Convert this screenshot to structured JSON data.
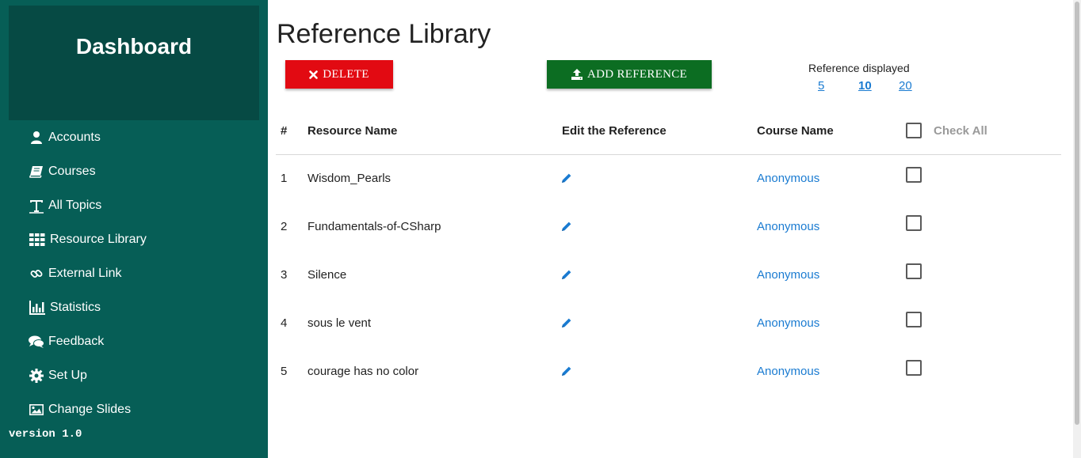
{
  "sidebar": {
    "brand": "Dashboard",
    "items": [
      {
        "label": "Accounts",
        "icon": "user-icon"
      },
      {
        "label": "Courses",
        "icon": "book-icon"
      },
      {
        "label": "All Topics",
        "icon": "text-icon"
      },
      {
        "label": "Resource Library",
        "icon": "grid-icon"
      },
      {
        "label": "External Link",
        "icon": "link-icon"
      },
      {
        "label": "Statistics",
        "icon": "bar-chart-icon"
      },
      {
        "label": "Feedback",
        "icon": "comments-icon"
      },
      {
        "label": "Set Up",
        "icon": "gear-icon"
      },
      {
        "label": "Change Slides",
        "icon": "image-icon"
      }
    ],
    "version": "version 1.0"
  },
  "main": {
    "title": "Reference Library",
    "delete_label": "DELETE",
    "add_label": "ADD REFERENCE",
    "per_page_label": "Reference displayed",
    "per_page_options": [
      "5",
      "10",
      "20"
    ],
    "per_page_selected": "10"
  },
  "table": {
    "headers": {
      "index": "#",
      "resource": "Resource Name",
      "edit": "Edit the Reference",
      "course": "Course Name",
      "check_all": "Check All"
    },
    "rows": [
      {
        "index": "1",
        "name": "Wisdom_Pearls",
        "course": "Anonymous"
      },
      {
        "index": "2",
        "name": "Fundamentals-of-CSharp",
        "course": "Anonymous"
      },
      {
        "index": "3",
        "name": "Silence",
        "course": "Anonymous"
      },
      {
        "index": "4",
        "name": "sous le vent",
        "course": "Anonymous"
      },
      {
        "index": "5",
        "name": "courage has no color",
        "course": "Anonymous"
      }
    ]
  },
  "colors": {
    "sidebar": "#065e56",
    "brand_panel": "#064a44",
    "delete": "#e20a12",
    "add": "#0c6d22",
    "link": "#1a7bd1"
  }
}
